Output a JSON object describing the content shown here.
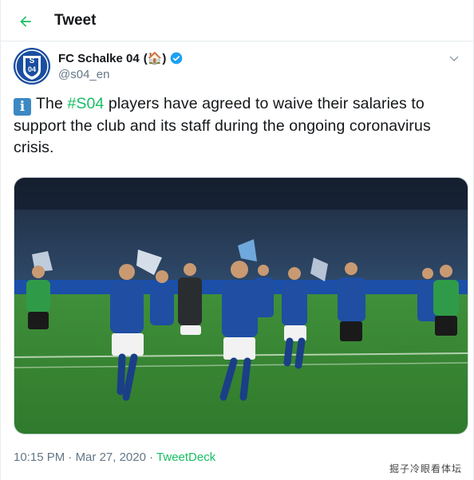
{
  "header": {
    "title": "Tweet"
  },
  "author": {
    "display_name": "FC Schalke 04",
    "name_emoji": "(🏠)",
    "handle": "@s04_en",
    "avatar_text": "04"
  },
  "tweet": {
    "info_emoji": "i",
    "text_before": "The ",
    "hashtag": "#S04",
    "text_after": " players have agreed to waive their salaries to support the club and its staff during the ongoing coronavirus crisis."
  },
  "meta": {
    "time": "10:15 PM",
    "date": "Mar 27, 2020",
    "sep": "·",
    "source": "TweetDeck"
  },
  "watermark": "掘子冷眼看体坛",
  "colors": {
    "accent": "#17bf63",
    "muted": "#657786",
    "verified": "#1da1f2",
    "brand": "#1a4ea0"
  },
  "icons": {
    "back": "arrow-left-icon",
    "verified": "verified-badge-icon",
    "more": "chevron-down-icon"
  }
}
